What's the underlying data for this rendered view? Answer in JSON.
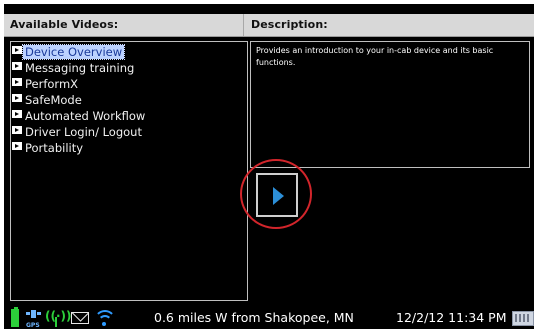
{
  "header": {
    "videos_title": "Available Videos:",
    "description_title": "Description:"
  },
  "videos": {
    "items": [
      {
        "label": "Device Overview",
        "selected": true
      },
      {
        "label": "Messaging training",
        "selected": false
      },
      {
        "label": "PerformX",
        "selected": false
      },
      {
        "label": "SafeMode",
        "selected": false
      },
      {
        "label": "Automated Workflow",
        "selected": false
      },
      {
        "label": "Driver Login/ Logout",
        "selected": false
      },
      {
        "label": "Portability",
        "selected": false
      }
    ]
  },
  "description": {
    "text": "Provides an introduction to your in-cab device and its basic functions."
  },
  "controls": {
    "play_icon": "play-icon"
  },
  "status": {
    "gps_label": "GPS",
    "location": "0.6 miles W from Shakopee, MN",
    "datetime": "12/2/12 11:34 PM",
    "icons": [
      "battery-icon",
      "gps-icon",
      "antenna-icon",
      "mail-icon",
      "wifi-icon",
      "keyboard-icon"
    ]
  },
  "colors": {
    "background": "#000000",
    "header": "#d8d8d8",
    "selection": "#bcd2ff",
    "play_accent": "#2c8fd8",
    "highlight_ring": "#d2252b",
    "status_green": "#2ccf3a",
    "wifi_blue": "#2f9bff"
  }
}
